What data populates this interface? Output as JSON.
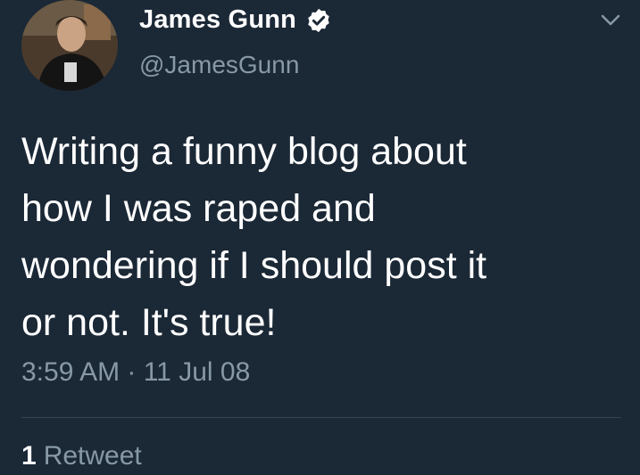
{
  "tweet": {
    "author_name": "James Gunn",
    "handle": "@JamesGunn",
    "text": "Writing a funny blog about\nhow I was raped and\nwondering if I should post it\nor not.  It's true!",
    "timestamp": "3:59 AM · 11 Jul 08",
    "retweet_count": "1",
    "retweet_label": "Retweet"
  },
  "icons": {
    "verified": "verified-badge-icon",
    "menu": "chevron-down-icon"
  },
  "colors": {
    "background": "#1b2836",
    "primary_text": "#ffffff",
    "secondary_text": "#8899a6",
    "divider": "#38444d"
  }
}
